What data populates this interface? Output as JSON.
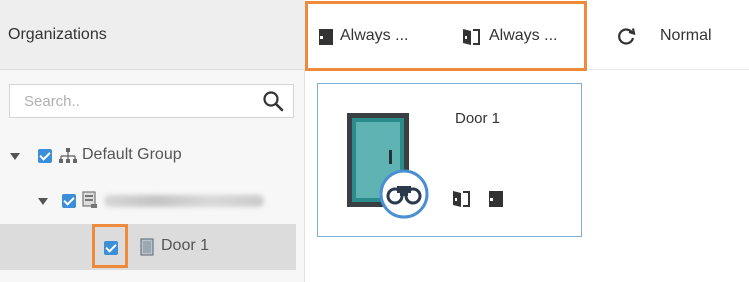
{
  "sidebar": {
    "title": "Organizations",
    "search": {
      "placeholder": "Search..",
      "value": ""
    },
    "tree": {
      "root": {
        "label": "Default Group",
        "checked": true,
        "expanded": true
      },
      "device": {
        "label": "",
        "checked": true,
        "expanded": true,
        "obscured": true
      },
      "door": {
        "label": "Door 1",
        "checked": true,
        "selected": true
      }
    }
  },
  "toolbar": {
    "always_open_label": "Always ...",
    "always_closed_label": "Always ...",
    "normal_label": "Normal"
  },
  "door_card": {
    "name": "Door 1"
  },
  "colors": {
    "highlight": "#ee8a3c",
    "checkbox": "#3a8fd8",
    "card_border": "#7fb0da",
    "door_teal": "#2b8c8c"
  },
  "icons": {
    "search": "search-icon",
    "org_tree": "org-tree-icon",
    "device": "device-icon",
    "door": "door-icon",
    "door_open": "door-open-icon",
    "door_closed": "door-closed-icon",
    "refresh": "refresh-icon",
    "binoculars": "binoculars-icon"
  }
}
